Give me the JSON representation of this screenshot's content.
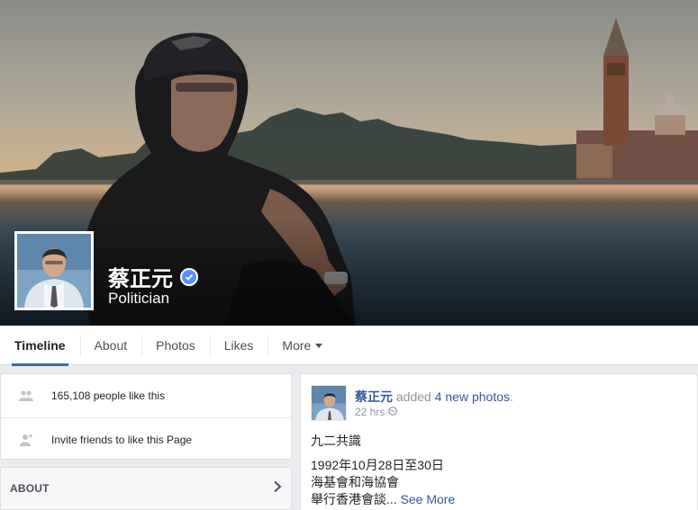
{
  "page": {
    "name": "蔡正元",
    "category": "Politician"
  },
  "tabs": [
    {
      "label": "Timeline"
    },
    {
      "label": "About"
    },
    {
      "label": "Photos"
    },
    {
      "label": "Likes"
    },
    {
      "label": "More"
    }
  ],
  "sidebar": {
    "likes_text": "165,108 people like this",
    "invite_text": "Invite friends to like this Page",
    "about_title": "ABOUT"
  },
  "post": {
    "author": "蔡正元",
    "action": " added ",
    "link": "4 new photos",
    "period": ".",
    "time": "22 hrs",
    "separator": " · ",
    "lines": [
      "九二共識",
      "1992年10月28日至30日",
      "海基會和海協會",
      "舉行香港會談..."
    ],
    "see_more": "See More"
  },
  "colors": {
    "accent": "#4267b2",
    "link": "#365899",
    "verified": "#5890ff"
  }
}
